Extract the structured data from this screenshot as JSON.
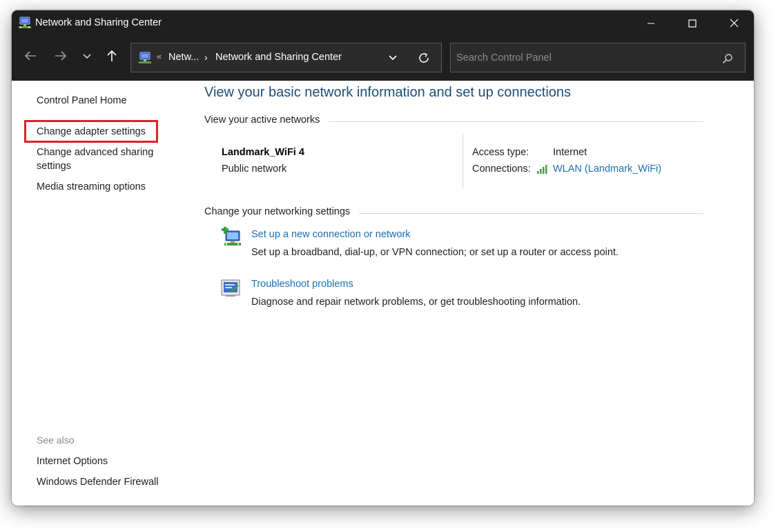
{
  "window": {
    "title": "Network and Sharing Center",
    "controls": {
      "minimize": "minimize-icon",
      "maximize": "maximize-icon",
      "close": "close-icon"
    }
  },
  "navigation": {
    "back_icon": "arrow-left-icon",
    "forward_icon": "arrow-right-icon",
    "recent_icon": "chevron-down-icon",
    "up_icon": "arrow-up-icon",
    "address": {
      "separator": "«",
      "crumb1": "Netw...",
      "chevron": "›",
      "crumb2": "Network and Sharing Center"
    },
    "search": {
      "placeholder": "Search Control Panel",
      "value": ""
    }
  },
  "sidebar": {
    "links": [
      {
        "label": "Control Panel Home"
      },
      {
        "label": "Change adapter settings"
      },
      {
        "label": "Change advanced sharing"
      },
      {
        "label": "settings"
      },
      {
        "label": "Media streaming options"
      }
    ],
    "see_also": {
      "heading": "See also",
      "links": [
        {
          "label": "Internet Options"
        },
        {
          "label": "Windows Defender Firewall"
        }
      ]
    }
  },
  "main": {
    "heading": "View your basic network information and set up connections",
    "active_networks": {
      "label": "View your active networks",
      "network_name": "Landmark_WiFi 4",
      "network_type": "Public network",
      "access_type_label": "Access type:",
      "access_type_value": "Internet",
      "connections_label": "Connections:",
      "connections_value": "WLAN (Landmark_WiFi)"
    },
    "networking_settings": {
      "label": "Change your networking settings",
      "tasks": [
        {
          "link": "Set up a new connection or network",
          "description": "Set up a broadband, dial-up, or VPN connection; or set up a router or access point."
        },
        {
          "link": "Troubleshoot problems",
          "description": "Diagnose and repair network problems, or get troubleshooting information."
        }
      ]
    }
  },
  "colors": {
    "titlebar_bg": "#1f1f1f",
    "heading_blue": "#1d4e78",
    "link_blue": "#1a6fb0",
    "highlight_red": "#d9232e"
  }
}
